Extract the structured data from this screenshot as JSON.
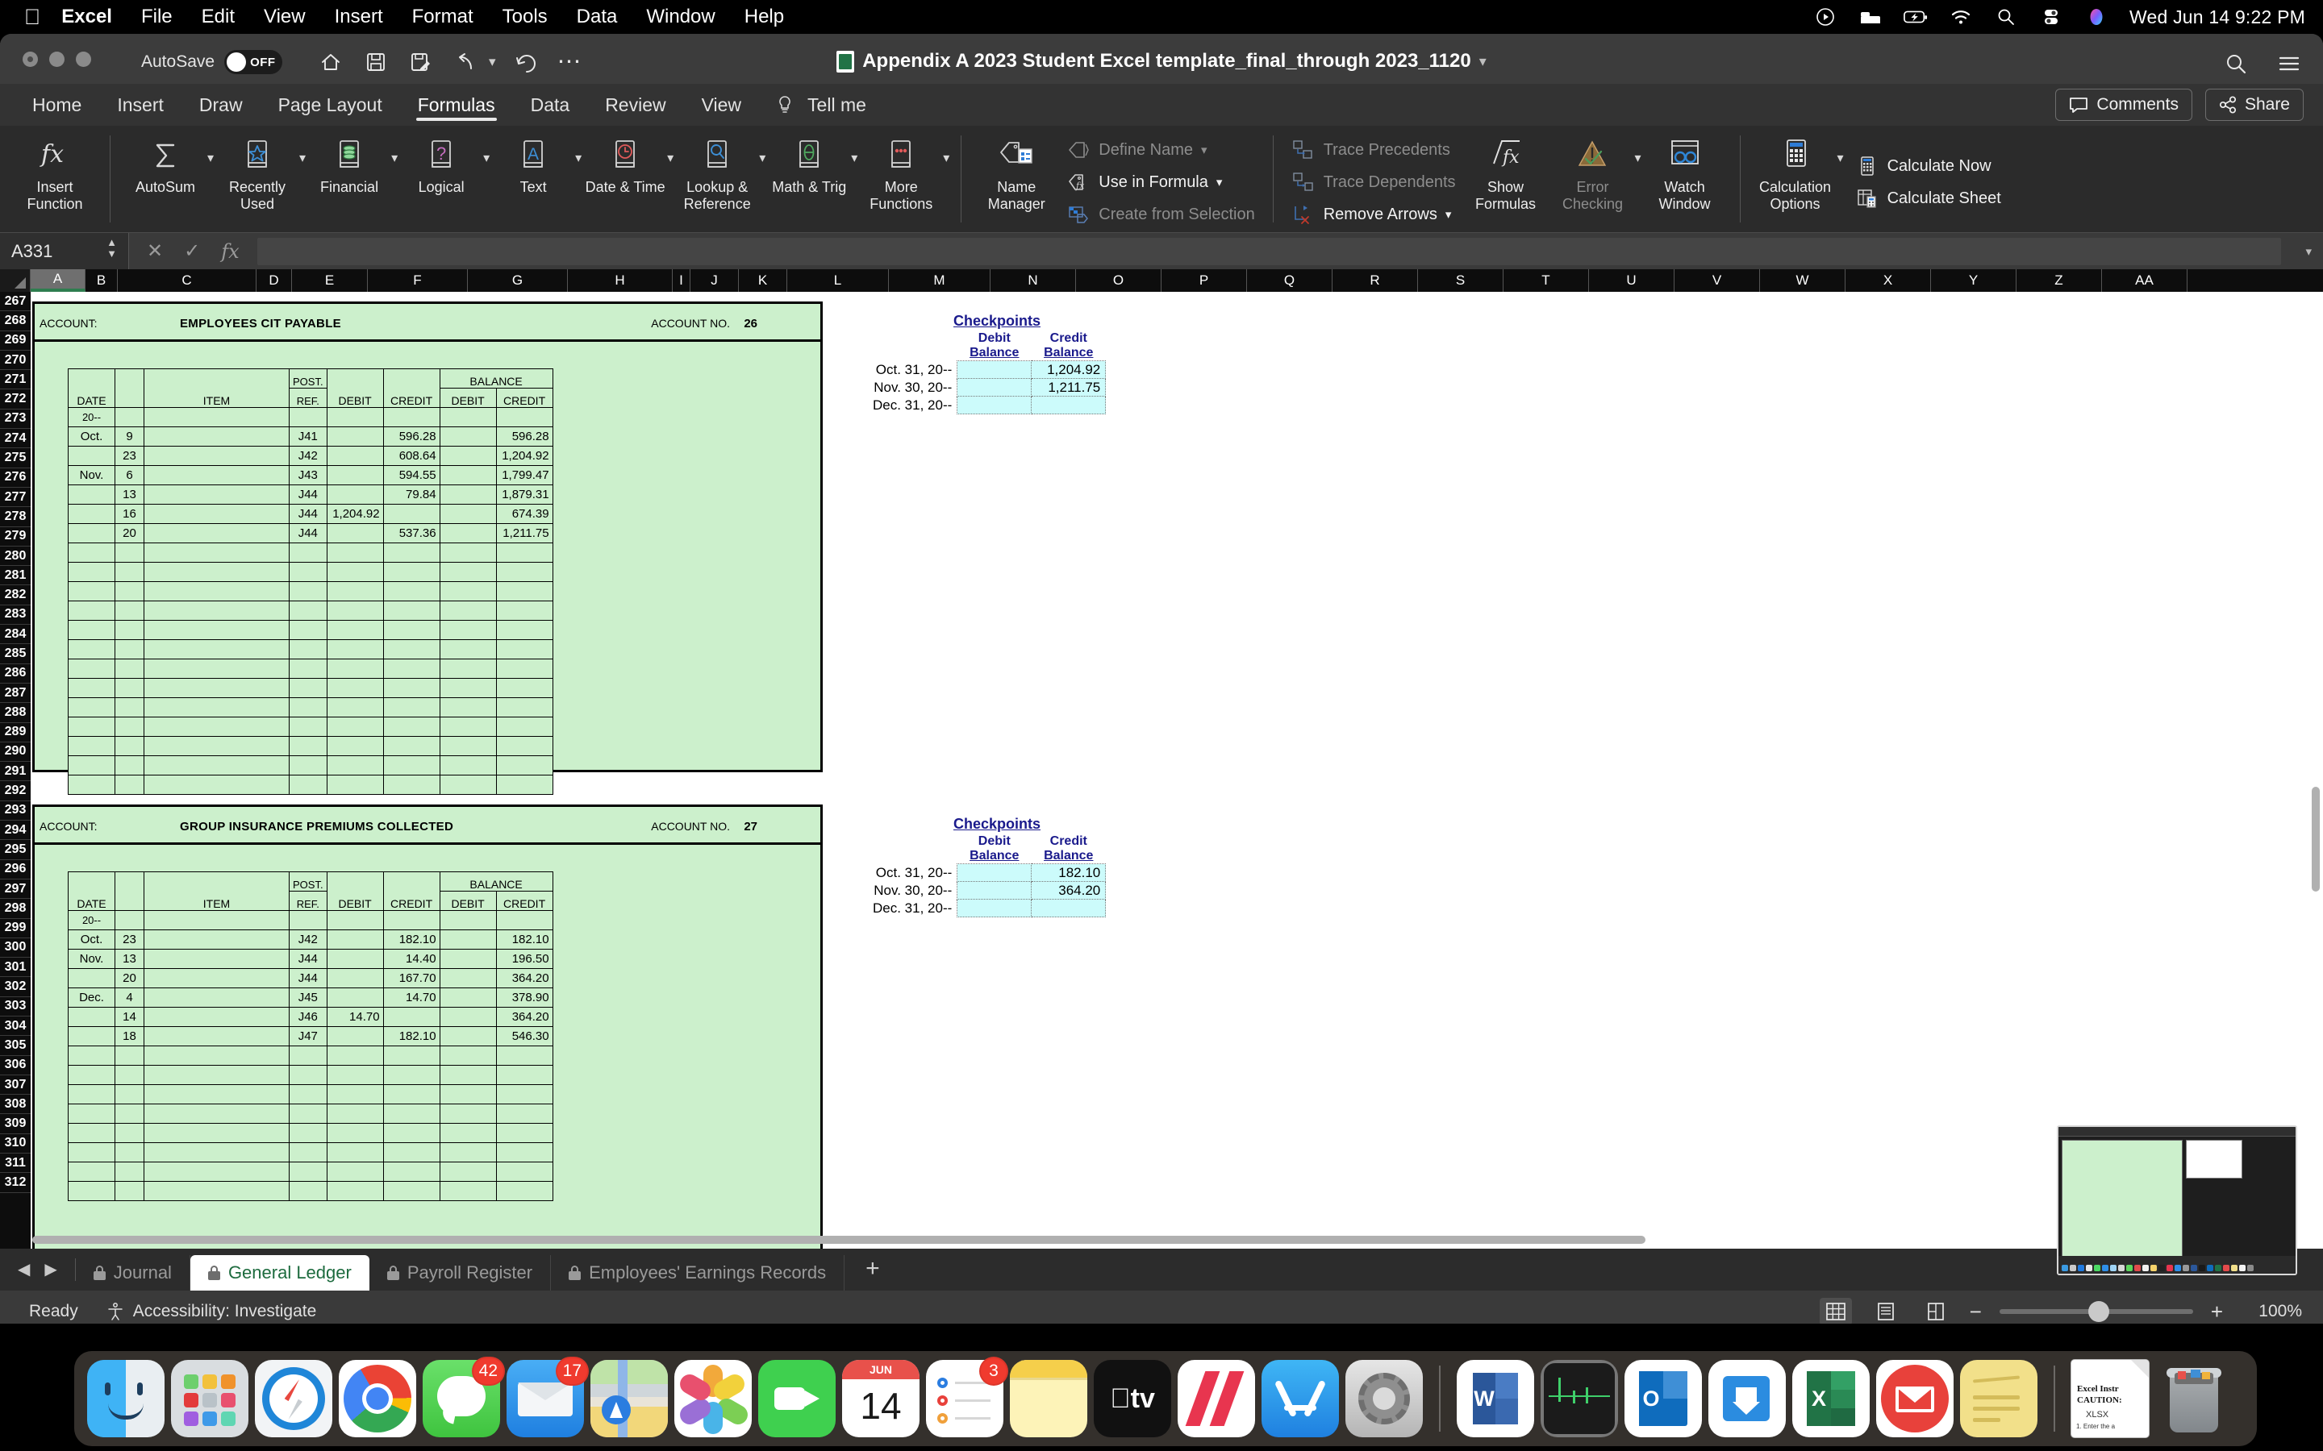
{
  "menubar": {
    "apple": "apple-logo",
    "items": [
      "Excel",
      "File",
      "Edit",
      "View",
      "Insert",
      "Format",
      "Tools",
      "Data",
      "Window",
      "Help"
    ],
    "status_icons": [
      "control-center-play-icon",
      "bed-icon",
      "battery-charging-icon",
      "wifi-icon",
      "search-icon",
      "control-center-icon",
      "siri-icon"
    ],
    "clock": "Wed Jun 14  9:22 PM"
  },
  "titlebar": {
    "autosave_label": "AutoSave",
    "autosave_state": "OFF",
    "document_title": "Appendix A 2023 Student Excel template_final_through 2023_1120",
    "quick_access": [
      "home-icon",
      "save-icon",
      "save-as-icon",
      "undo-icon",
      "redo-icon",
      "more-icon"
    ],
    "search_icon": "search-icon",
    "ribbon_display_icon": "ribbon-display-options-icon"
  },
  "ribbon": {
    "tabs": [
      "Home",
      "Insert",
      "Draw",
      "Page Layout",
      "Formulas",
      "Data",
      "Review",
      "View",
      "Tell me"
    ],
    "active_tab": "Formulas",
    "tell_me_icon": "lightbulb-icon",
    "comments_label": "Comments",
    "comments_icon": "comment-icon",
    "share_label": "Share",
    "share_icon": "share-icon",
    "function_library": [
      {
        "label": "Insert Function",
        "icon": "fx-icon",
        "caret": false
      },
      {
        "label": "AutoSum",
        "icon": "sigma-icon",
        "caret": true
      },
      {
        "label": "Recently Used",
        "icon": "star-book-icon",
        "caret": true
      },
      {
        "label": "Financial",
        "icon": "coins-book-icon",
        "caret": true
      },
      {
        "label": "Logical",
        "icon": "question-book-icon",
        "caret": true
      },
      {
        "label": "Text",
        "icon": "a-book-icon",
        "caret": true
      },
      {
        "label": "Date & Time",
        "icon": "clock-book-icon",
        "caret": true
      },
      {
        "label": "Lookup & Reference",
        "icon": "magnifier-book-icon",
        "caret": true
      },
      {
        "label": "Math & Trig",
        "icon": "theta-book-icon",
        "caret": true
      },
      {
        "label": "More Functions",
        "icon": "dots-book-icon",
        "caret": true
      }
    ],
    "defined_names": {
      "name_manager": {
        "label": "Name Manager",
        "icon": "tag-list-icon"
      },
      "rows": [
        {
          "label": "Define Name",
          "icon": "tag-icon",
          "caret": true,
          "enabled": false
        },
        {
          "label": "Use in Formula",
          "icon": "tag-fx-icon",
          "caret": true,
          "enabled": true
        },
        {
          "label": "Create from Selection",
          "icon": "grid-tag-icon",
          "caret": false,
          "enabled": false
        }
      ]
    },
    "formula_auditing": {
      "rows": [
        {
          "label": "Trace Precedents",
          "icon": "trace-precedents-icon",
          "caret": false,
          "enabled": false
        },
        {
          "label": "Trace Dependents",
          "icon": "trace-dependents-icon",
          "caret": false,
          "enabled": false
        },
        {
          "label": "Remove Arrows",
          "icon": "remove-arrows-icon",
          "caret": true,
          "enabled": true
        }
      ],
      "buttons": [
        {
          "label": "Show Formulas",
          "icon": "show-formulas-icon",
          "enabled": true
        },
        {
          "label": "Error Checking",
          "icon": "error-checking-icon",
          "caret": true,
          "enabled": false
        },
        {
          "label": "Watch Window",
          "icon": "watch-window-icon",
          "enabled": true
        }
      ]
    },
    "calculation": {
      "options": {
        "label": "Calculation Options",
        "icon": "calculator-icon",
        "caret": true
      },
      "rows": [
        {
          "label": "Calculate Now",
          "icon": "calculate-now-icon"
        },
        {
          "label": "Calculate Sheet",
          "icon": "calculate-sheet-icon"
        }
      ]
    }
  },
  "formula_bar": {
    "name_box": "A331",
    "cancel_icon": "cancel-icon",
    "enter_icon": "enter-icon",
    "fx_icon": "fx-icon",
    "value": ""
  },
  "grid": {
    "columns": [
      "A",
      "B",
      "C",
      "D",
      "E",
      "F",
      "G",
      "H",
      "I",
      "J",
      "K",
      "L",
      "M",
      "N",
      "O",
      "P",
      "Q",
      "R",
      "S",
      "T",
      "U",
      "V",
      "W",
      "X",
      "Y",
      "Z",
      "AA"
    ],
    "selected_column": "A",
    "row_start": 268,
    "row_numbers": [
      267,
      268,
      269,
      270,
      271,
      272,
      273,
      274,
      275,
      276,
      277,
      278,
      279,
      280,
      281,
      282,
      283,
      284,
      285,
      286,
      287,
      288,
      289,
      290,
      291,
      292,
      293,
      294,
      295,
      296,
      297,
      298,
      299,
      300,
      301,
      302,
      303,
      304,
      305,
      306,
      307,
      308,
      309,
      310,
      311,
      312
    ]
  },
  "ledgers": [
    {
      "account_label": "ACCOUNT:",
      "account_name": "EMPLOYEES CIT PAYABLE",
      "account_no_label": "ACCOUNT NO.",
      "account_no": "26",
      "headers": {
        "date": "DATE",
        "item": "ITEM",
        "post_ref_1": "POST.",
        "post_ref_2": "REF.",
        "debit": "DEBIT",
        "credit": "CREDIT",
        "balance": "BALANCE",
        "balance_debit": "DEBIT",
        "balance_credit": "CREDIT"
      },
      "year_row": "20--",
      "rows": [
        {
          "month": "Oct.",
          "day": "9",
          "item": "",
          "ref": "J41",
          "debit": "",
          "credit": "596.28",
          "bal_debit": "",
          "bal_credit": "596.28"
        },
        {
          "month": "",
          "day": "23",
          "item": "",
          "ref": "J42",
          "debit": "",
          "credit": "608.64",
          "bal_debit": "",
          "bal_credit": "1,204.92"
        },
        {
          "month": "Nov.",
          "day": "6",
          "item": "",
          "ref": "J43",
          "debit": "",
          "credit": "594.55",
          "bal_debit": "",
          "bal_credit": "1,799.47"
        },
        {
          "month": "",
          "day": "13",
          "item": "",
          "ref": "J44",
          "debit": "",
          "credit": "79.84",
          "bal_debit": "",
          "bal_credit": "1,879.31"
        },
        {
          "month": "",
          "day": "16",
          "item": "",
          "ref": "J44",
          "debit": "1,204.92",
          "credit": "",
          "bal_debit": "",
          "bal_credit": "674.39"
        },
        {
          "month": "",
          "day": "20",
          "item": "",
          "ref": "J44",
          "debit": "",
          "credit": "537.36",
          "bal_debit": "",
          "bal_credit": "1,211.75"
        },
        {
          "month": "",
          "day": "",
          "item": "",
          "ref": "",
          "debit": "",
          "credit": "",
          "bal_debit": "",
          "bal_credit": ""
        },
        {
          "month": "",
          "day": "",
          "item": "",
          "ref": "",
          "debit": "",
          "credit": "",
          "bal_debit": "",
          "bal_credit": ""
        },
        {
          "month": "",
          "day": "",
          "item": "",
          "ref": "",
          "debit": "",
          "credit": "",
          "bal_debit": "",
          "bal_credit": ""
        },
        {
          "month": "",
          "day": "",
          "item": "",
          "ref": "",
          "debit": "",
          "credit": "",
          "bal_debit": "",
          "bal_credit": ""
        },
        {
          "month": "",
          "day": "",
          "item": "",
          "ref": "",
          "debit": "",
          "credit": "",
          "bal_debit": "",
          "bal_credit": ""
        },
        {
          "month": "",
          "day": "",
          "item": "",
          "ref": "",
          "debit": "",
          "credit": "",
          "bal_debit": "",
          "bal_credit": ""
        },
        {
          "month": "",
          "day": "",
          "item": "",
          "ref": "",
          "debit": "",
          "credit": "",
          "bal_debit": "",
          "bal_credit": ""
        },
        {
          "month": "",
          "day": "",
          "item": "",
          "ref": "",
          "debit": "",
          "credit": "",
          "bal_debit": "",
          "bal_credit": ""
        },
        {
          "month": "",
          "day": "",
          "item": "",
          "ref": "",
          "debit": "",
          "credit": "",
          "bal_debit": "",
          "bal_credit": ""
        },
        {
          "month": "",
          "day": "",
          "item": "",
          "ref": "",
          "debit": "",
          "credit": "",
          "bal_debit": "",
          "bal_credit": ""
        },
        {
          "month": "",
          "day": "",
          "item": "",
          "ref": "",
          "debit": "",
          "credit": "",
          "bal_debit": "",
          "bal_credit": ""
        },
        {
          "month": "",
          "day": "",
          "item": "",
          "ref": "",
          "debit": "",
          "credit": "",
          "bal_debit": "",
          "bal_credit": ""
        },
        {
          "month": "",
          "day": "",
          "item": "",
          "ref": "",
          "debit": "",
          "credit": "",
          "bal_debit": "",
          "bal_credit": ""
        }
      ],
      "checkpoints": {
        "title": "Checkpoints",
        "col_debit_1": "Debit",
        "col_debit_2": "Balance",
        "col_credit_1": "Credit",
        "col_credit_2": "Balance",
        "rows": [
          {
            "label": "Oct. 31, 20--",
            "debit": "",
            "credit": "1,204.92"
          },
          {
            "label": "Nov. 30, 20--",
            "debit": "",
            "credit": "1,211.75"
          },
          {
            "label": "Dec. 31, 20--",
            "debit": "",
            "credit": ""
          }
        ]
      }
    },
    {
      "account_label": "ACCOUNT:",
      "account_name": "GROUP INSURANCE PREMIUMS COLLECTED",
      "account_no_label": "ACCOUNT NO.",
      "account_no": "27",
      "headers": {
        "date": "DATE",
        "item": "ITEM",
        "post_ref_1": "POST.",
        "post_ref_2": "REF.",
        "debit": "DEBIT",
        "credit": "CREDIT",
        "balance": "BALANCE",
        "balance_debit": "DEBIT",
        "balance_credit": "CREDIT"
      },
      "year_row": "20--",
      "rows": [
        {
          "month": "Oct.",
          "day": "23",
          "item": "",
          "ref": "J42",
          "debit": "",
          "credit": "182.10",
          "bal_debit": "",
          "bal_credit": "182.10"
        },
        {
          "month": "Nov.",
          "day": "13",
          "item": "",
          "ref": "J44",
          "debit": "",
          "credit": "14.40",
          "bal_debit": "",
          "bal_credit": "196.50"
        },
        {
          "month": "",
          "day": "20",
          "item": "",
          "ref": "J44",
          "debit": "",
          "credit": "167.70",
          "bal_debit": "",
          "bal_credit": "364.20"
        },
        {
          "month": "Dec.",
          "day": "4",
          "item": "",
          "ref": "J45",
          "debit": "",
          "credit": "14.70",
          "bal_debit": "",
          "bal_credit": "378.90"
        },
        {
          "month": "",
          "day": "14",
          "item": "",
          "ref": "J46",
          "debit": "14.70",
          "credit": "",
          "bal_debit": "",
          "bal_credit": "364.20"
        },
        {
          "month": "",
          "day": "18",
          "item": "",
          "ref": "J47",
          "debit": "",
          "credit": "182.10",
          "bal_debit": "",
          "bal_credit": "546.30"
        },
        {
          "month": "",
          "day": "",
          "item": "",
          "ref": "",
          "debit": "",
          "credit": "",
          "bal_debit": "",
          "bal_credit": ""
        },
        {
          "month": "",
          "day": "",
          "item": "",
          "ref": "",
          "debit": "",
          "credit": "",
          "bal_debit": "",
          "bal_credit": ""
        },
        {
          "month": "",
          "day": "",
          "item": "",
          "ref": "",
          "debit": "",
          "credit": "",
          "bal_debit": "",
          "bal_credit": ""
        },
        {
          "month": "",
          "day": "",
          "item": "",
          "ref": "",
          "debit": "",
          "credit": "",
          "bal_debit": "",
          "bal_credit": ""
        },
        {
          "month": "",
          "day": "",
          "item": "",
          "ref": "",
          "debit": "",
          "credit": "",
          "bal_debit": "",
          "bal_credit": ""
        },
        {
          "month": "",
          "day": "",
          "item": "",
          "ref": "",
          "debit": "",
          "credit": "",
          "bal_debit": "",
          "bal_credit": ""
        },
        {
          "month": "",
          "day": "",
          "item": "",
          "ref": "",
          "debit": "",
          "credit": "",
          "bal_debit": "",
          "bal_credit": ""
        },
        {
          "month": "",
          "day": "",
          "item": "",
          "ref": "",
          "debit": "",
          "credit": "",
          "bal_debit": "",
          "bal_credit": ""
        }
      ],
      "checkpoints": {
        "title": "Checkpoints",
        "col_debit_1": "Debit",
        "col_debit_2": "Balance",
        "col_credit_1": "Credit",
        "col_credit_2": "Balance",
        "rows": [
          {
            "label": "Oct. 31, 20--",
            "debit": "",
            "credit": "182.10"
          },
          {
            "label": "Nov. 30, 20--",
            "debit": "",
            "credit": "364.20"
          },
          {
            "label": "Dec. 31, 20--",
            "debit": "",
            "credit": ""
          }
        ]
      }
    }
  ],
  "sheet_tabs": {
    "prev_icon": "previous-sheet-icon",
    "next_icon": "next-sheet-icon",
    "add_label": "+",
    "tabs": [
      {
        "label": "Journal",
        "locked": true,
        "active": false
      },
      {
        "label": "General Ledger",
        "locked": true,
        "active": true
      },
      {
        "label": "Payroll Register",
        "locked": true,
        "active": false
      },
      {
        "label": "Employees' Earnings Records",
        "locked": true,
        "active": false
      }
    ]
  },
  "statusbar": {
    "status": "Ready",
    "accessibility": "Accessibility: Investigate",
    "accessibility_icon": "accessibility-icon",
    "views": [
      "normal-view-icon",
      "page-layout-view-icon",
      "page-break-view-icon"
    ],
    "active_view": "normal-view-icon",
    "zoom_out_icon": "minus-icon",
    "zoom_in_icon": "plus-icon",
    "zoom_level": "100%"
  },
  "dock": {
    "items": [
      {
        "name": "finder",
        "badge": ""
      },
      {
        "name": "launchpad",
        "badge": ""
      },
      {
        "name": "safari",
        "badge": ""
      },
      {
        "name": "chrome",
        "badge": ""
      },
      {
        "name": "messages",
        "badge": "42"
      },
      {
        "name": "mail",
        "badge": "17"
      },
      {
        "name": "maps",
        "badge": ""
      },
      {
        "name": "photos",
        "badge": ""
      },
      {
        "name": "facetime",
        "badge": ""
      },
      {
        "name": "calendar",
        "badge": "",
        "month": "JUN",
        "day": "14"
      },
      {
        "name": "reminders",
        "badge": "3"
      },
      {
        "name": "notes",
        "badge": ""
      },
      {
        "name": "apple-tv",
        "badge": ""
      },
      {
        "name": "news",
        "badge": ""
      },
      {
        "name": "app-store",
        "badge": ""
      },
      {
        "name": "system-settings",
        "badge": ""
      },
      {
        "name": "separator",
        "badge": ""
      },
      {
        "name": "microsoft-word",
        "badge": ""
      },
      {
        "name": "activity-monitor",
        "badge": ""
      },
      {
        "name": "microsoft-outlook",
        "badge": ""
      },
      {
        "name": "microsoft-onedrive",
        "badge": ""
      },
      {
        "name": "microsoft-excel",
        "badge": ""
      },
      {
        "name": "gmail",
        "badge": ""
      },
      {
        "name": "stickies",
        "badge": ""
      },
      {
        "name": "separator",
        "badge": ""
      },
      {
        "name": "excel-instructions-file",
        "badge": "",
        "line1": "Excel Instr",
        "line2": "CAUTION:",
        "line3": "XLSX",
        "line4": "1. Enter the a"
      },
      {
        "name": "trash",
        "badge": ""
      }
    ]
  }
}
